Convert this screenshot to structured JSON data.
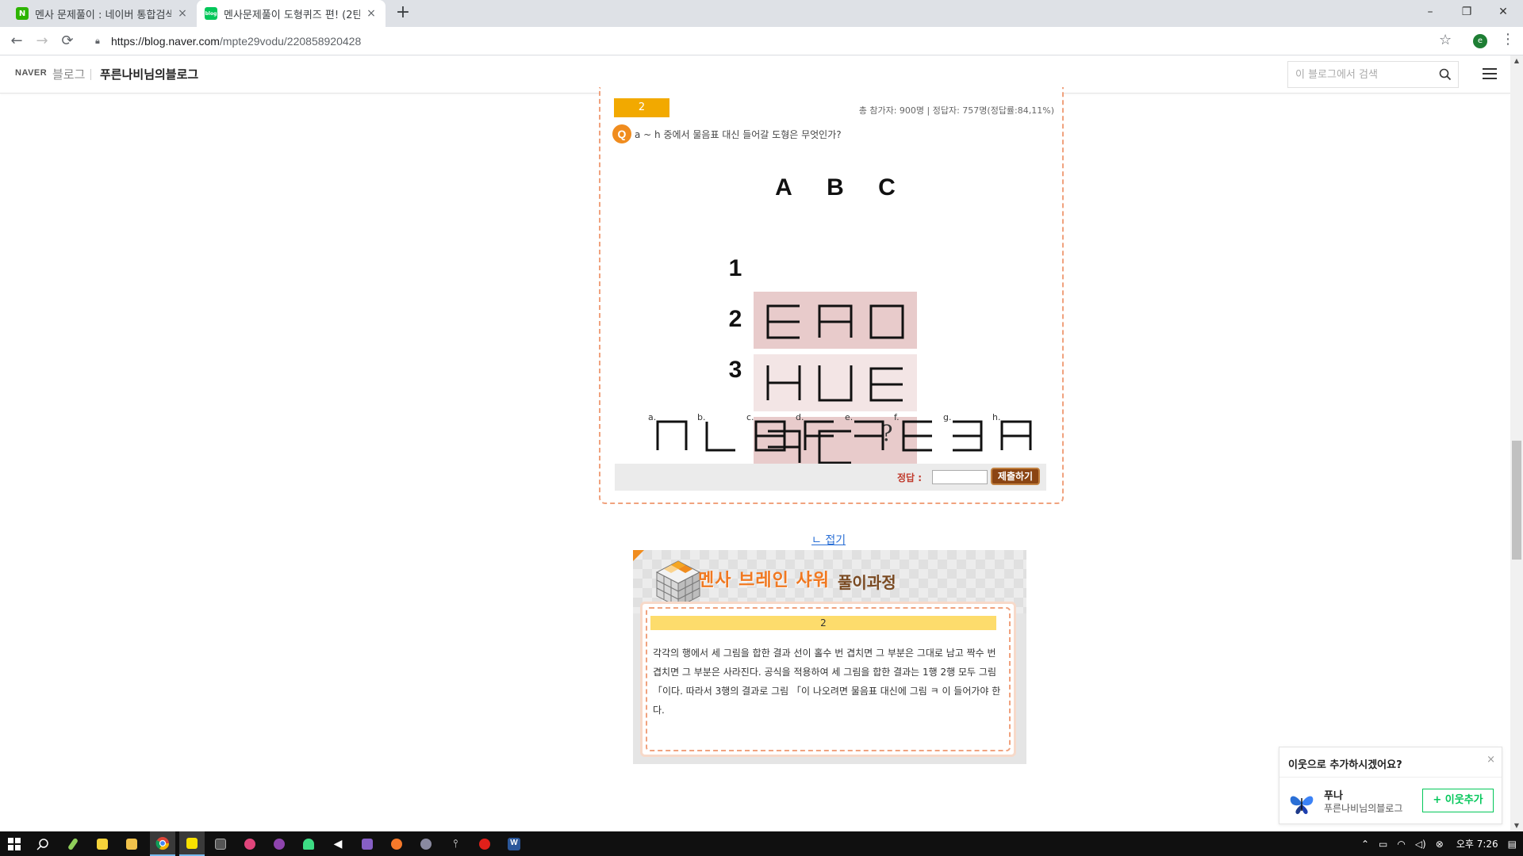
{
  "browser": {
    "tabs": [
      {
        "title": "멘사 문제풀이 : 네이버 통합검색",
        "favicon": "naver-n-icon",
        "active": false
      },
      {
        "title": "멘사문제풀이 도형퀴즈 편! (2탄",
        "favicon": "naver-blog-icon",
        "active": true
      }
    ],
    "new_tab": "+",
    "window": {
      "minimize": "–",
      "restore": "❐",
      "close": "✕"
    },
    "url_host": "https://blog.naver.com",
    "url_path": "/mpte29vodu/220858920428",
    "profile_initial": "e"
  },
  "blog_header": {
    "naver_logo": "NAVER",
    "blog_word": "블로그",
    "blog_title": "푸른나비님의블로그",
    "search_placeholder": "이 블로그에서 검색"
  },
  "quiz": {
    "number": "2",
    "stats": "총 참가자: 900명 | 정답자: 757명(정답률:84,11%)",
    "q_icon": "Q",
    "question": "a ~ h 중에서 물음표 대신 들어갈 도형은 무엇인가?",
    "columns": [
      "A",
      "B",
      "C"
    ],
    "rows": [
      "1",
      "2",
      "3"
    ],
    "question_mark": "?",
    "options": [
      "a.",
      "b.",
      "c.",
      "d.",
      "e.",
      "f.",
      "g.",
      "h."
    ],
    "answer_label": "정답 :",
    "answer_value": "",
    "submit_label": "제출하기"
  },
  "fold_link": "ㄴ 접기",
  "solution": {
    "title": "멘사 브레인 샤워",
    "subtitle": "풀이과정",
    "number": "2",
    "text": "각각의 행에서 세 그림을 합한 결과 선이 홀수 번 겹치면 그 부분은 그대로 남고 짝수 번 겹치면 그 부분은 사라진다. 공식을 적용하여 세 그림을 합한 결과는 1행 2행 모두 그림 「이다. 따라서 3행의 결과로 그림 「이 나오려면 물음표 대신에 그림 ㅋ 이 들어가야 한다."
  },
  "neighbor_popup": {
    "question": "이웃으로 추가하시겠어요?",
    "close": "×",
    "name": "푸나",
    "blog": "푸른나비님의블로그",
    "add_button": "+ 이웃추가"
  },
  "taskbar": {
    "clock": "오후 7:26"
  },
  "colors": {
    "accent_orange": "#f08c1e",
    "quiz_number_bg": "#f2a900",
    "naver_green": "#03c75a",
    "cell_dark": "#e8cbcb",
    "cell_light": "#f3e5e5"
  }
}
